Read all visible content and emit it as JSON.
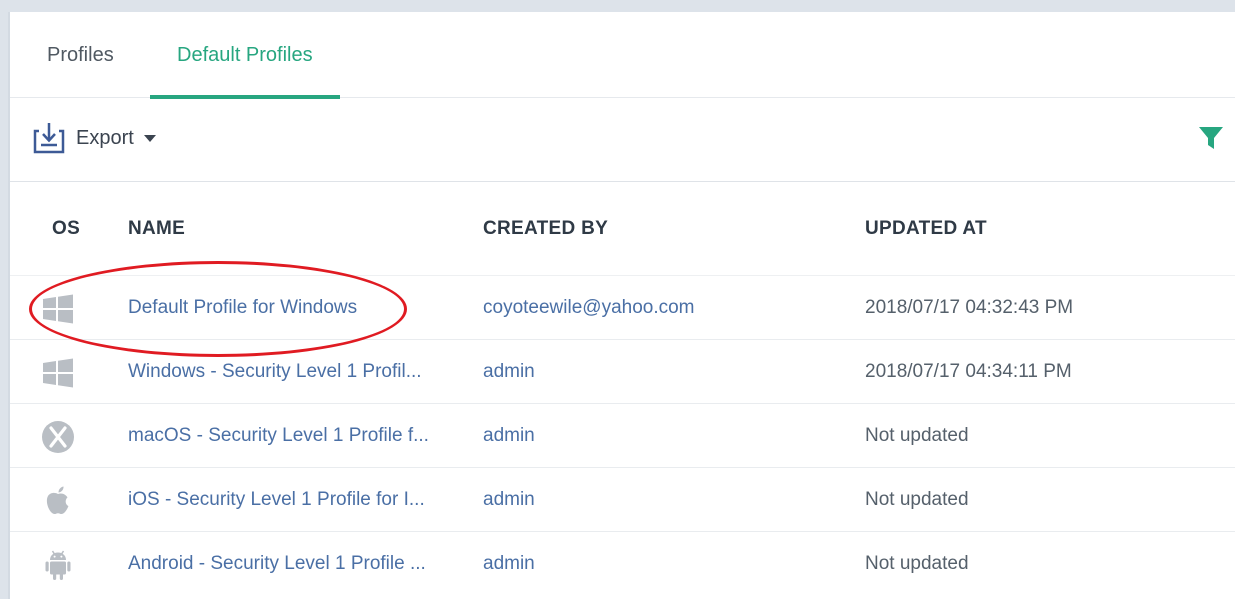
{
  "tabs": [
    {
      "label": "Profiles",
      "active": false
    },
    {
      "label": "Default Profiles",
      "active": true
    }
  ],
  "toolbar": {
    "export_label": "Export",
    "export_icon": "export-download-icon",
    "filter_icon": "filter-icon"
  },
  "table": {
    "headers": {
      "os": "OS",
      "name": "NAME",
      "created_by": "CREATED BY",
      "updated_at": "UPDATED AT"
    },
    "rows": [
      {
        "os": "windows-icon",
        "name": "Default Profile for Windows",
        "created_by": "coyoteewile@yahoo.com",
        "updated_at": "2018/07/17 04:32:43 PM"
      },
      {
        "os": "windows-icon",
        "name": "Windows - Security Level 1 Profil...",
        "created_by": "admin",
        "updated_at": "2018/07/17 04:34:11 PM"
      },
      {
        "os": "macos-icon",
        "name": "macOS - Security Level 1 Profile f...",
        "created_by": "admin",
        "updated_at": "Not updated"
      },
      {
        "os": "apple-icon",
        "name": "iOS - Security Level 1 Profile for I...",
        "created_by": "admin",
        "updated_at": "Not updated"
      },
      {
        "os": "android-icon",
        "name": "Android - Security Level 1 Profile ...",
        "created_by": "admin",
        "updated_at": "Not updated"
      }
    ]
  },
  "colors": {
    "accent": "#27a680",
    "link": "#4a6fa5",
    "annotation": "#e01b22"
  }
}
